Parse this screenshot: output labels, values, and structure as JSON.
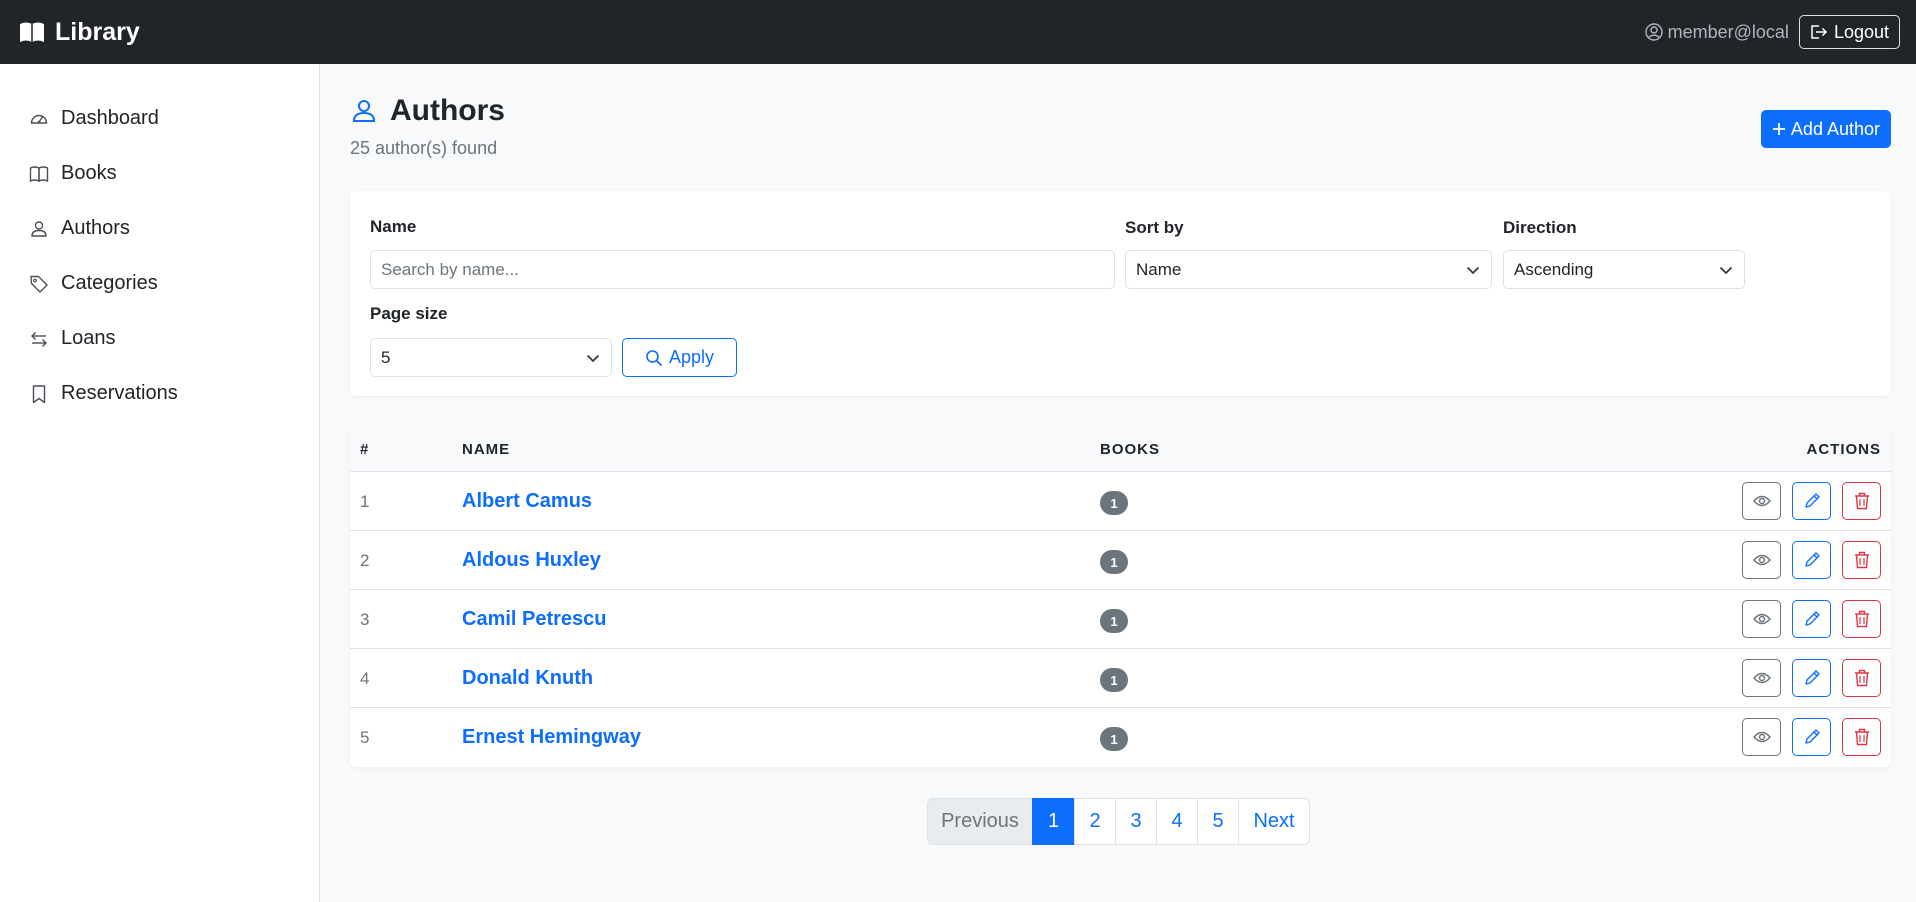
{
  "app": {
    "brand": "Library"
  },
  "topbar": {
    "user": "member@local",
    "logout_label": "Logout"
  },
  "sidebar": {
    "items": [
      {
        "label": "Dashboard",
        "icon": "speedometer-icon"
      },
      {
        "label": "Books",
        "icon": "book-icon"
      },
      {
        "label": "Authors",
        "icon": "person-icon"
      },
      {
        "label": "Categories",
        "icon": "tag-icon"
      },
      {
        "label": "Loans",
        "icon": "arrows-icon"
      },
      {
        "label": "Reservations",
        "icon": "bookmark-icon"
      }
    ]
  },
  "page": {
    "title": "Authors",
    "subtitle": "25 author(s) found",
    "add_label": "Add Author"
  },
  "filters": {
    "name_label": "Name",
    "name_placeholder": "Search by name...",
    "name_value": "",
    "sort_label": "Sort by",
    "sort_value": "Name",
    "direction_label": "Direction",
    "direction_value": "Ascending",
    "page_size_label": "Page size",
    "page_size_value": "5",
    "apply_label": "Apply"
  },
  "table": {
    "headers": {
      "num": "#",
      "name": "NAME",
      "books": "BOOKS",
      "actions": "ACTIONS"
    },
    "rows": [
      {
        "num": "1",
        "name": "Albert Camus",
        "books": "1"
      },
      {
        "num": "2",
        "name": "Aldous Huxley",
        "books": "1"
      },
      {
        "num": "3",
        "name": "Camil Petrescu",
        "books": "1"
      },
      {
        "num": "4",
        "name": "Donald Knuth",
        "books": "1"
      },
      {
        "num": "5",
        "name": "Ernest Hemingway",
        "books": "1"
      }
    ]
  },
  "pagination": {
    "previous": "Previous",
    "pages": [
      "1",
      "2",
      "3",
      "4",
      "5"
    ],
    "active": "1",
    "next": "Next"
  },
  "colors": {
    "primary": "#0d6efd",
    "danger": "#dc3545",
    "secondary": "#6c757d",
    "navbar": "#212529"
  }
}
